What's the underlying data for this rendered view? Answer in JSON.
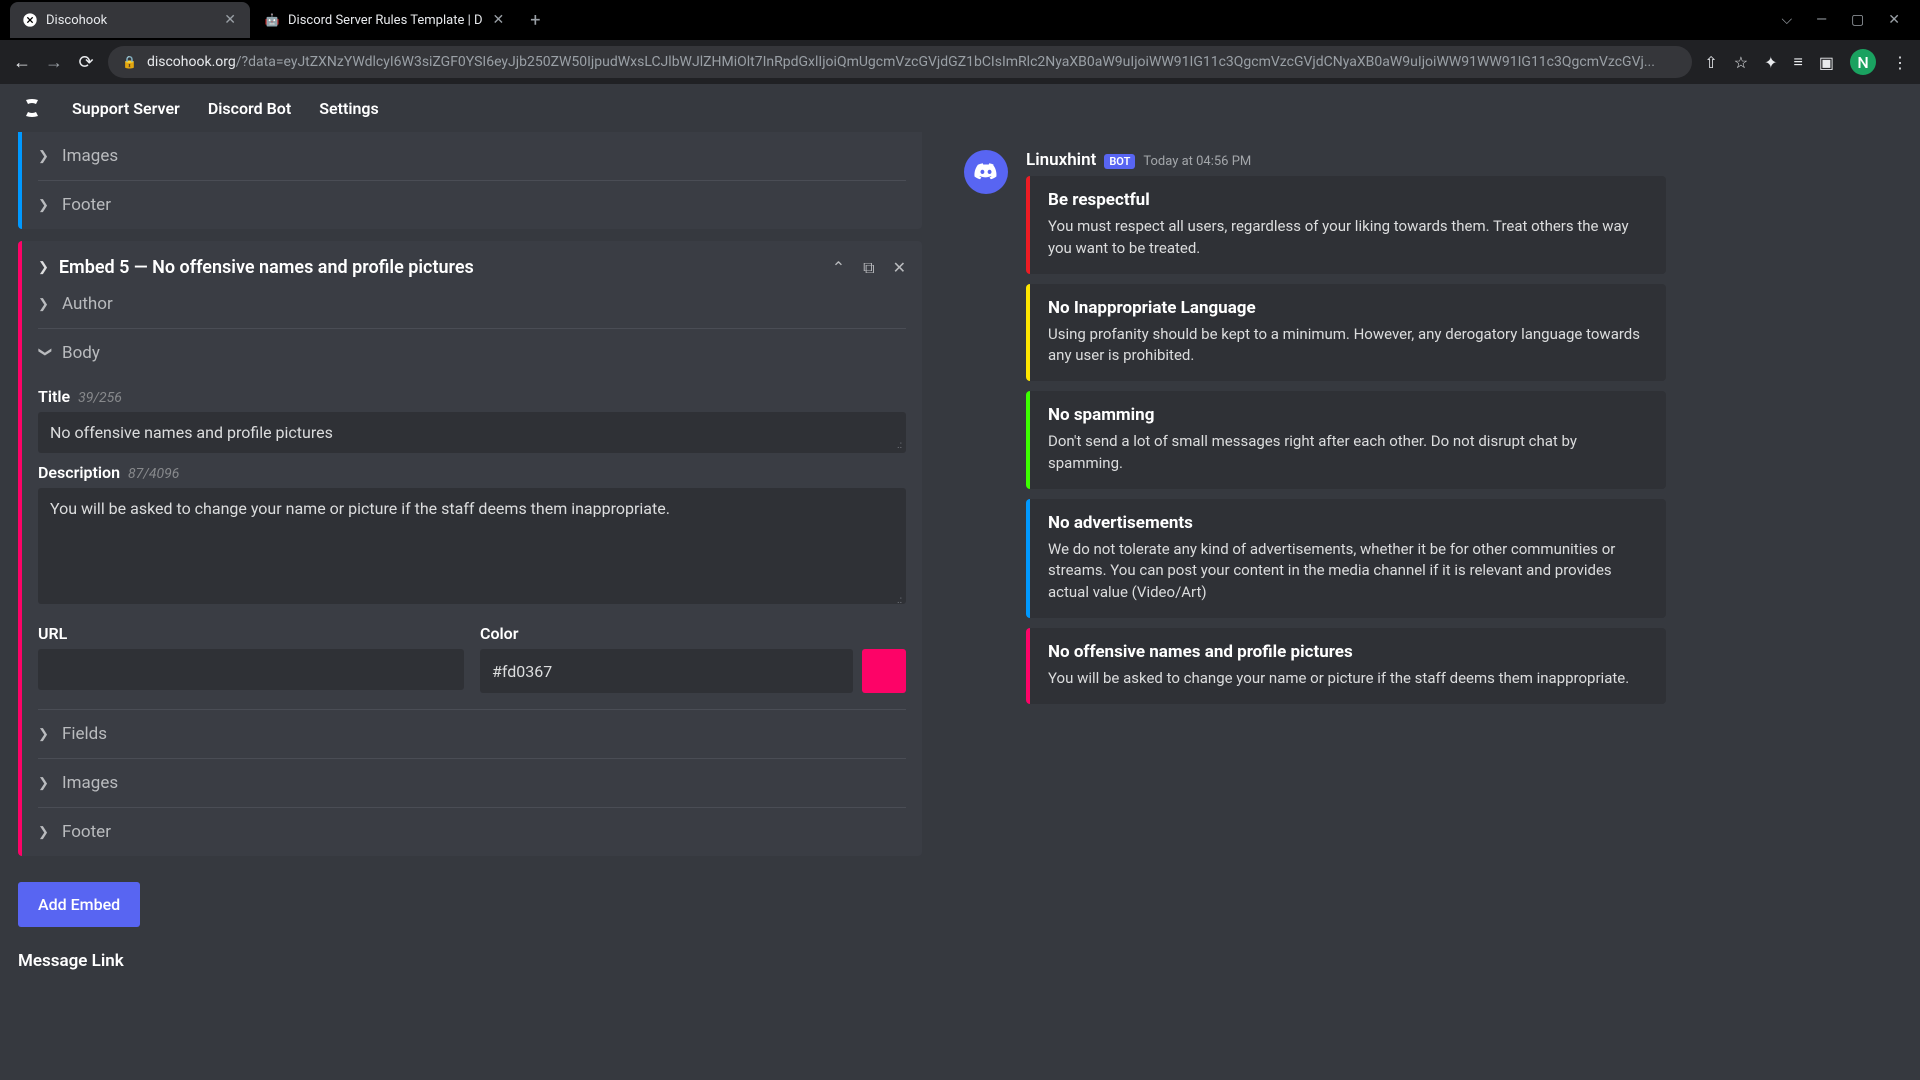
{
  "browser": {
    "tabs": [
      {
        "title": "Discohook",
        "favicon": "S",
        "active": true
      },
      {
        "title": "Discord Server Rules Template | D",
        "favicon": "🤖",
        "active": false
      }
    ],
    "url_prefix": "discohook.org",
    "url_path": "/?data=eyJtZXNzYWdlcyI6W3siZGF0YSI6eyJjb250ZW50IjpudWxsLCJlbWJlZHMiOlt7InRpdGxlIjoiQmUgcmVzcGVjdGZ1bCIsImRlc2NyaXB0aW9uIjoiWW91IG11c3QgcmVzcGVjdCNyaXB0aW9uIjoiWW91WW91IG11c3QgcmVzcGVj...",
    "window_controls": {
      "dropdown": "⌵",
      "minimize": "—",
      "maximize": "▢",
      "close": "✕"
    },
    "profile_letter": "N"
  },
  "app_nav": {
    "support_server": "Support Server",
    "discord_bot": "Discord Bot",
    "settings": "Settings"
  },
  "editor": {
    "prev_embed": {
      "color": "#0099ff",
      "images": "Images",
      "footer": "Footer"
    },
    "embed5": {
      "header": "Embed 5 — No offensive names and profile pictures",
      "color_border": "#fd0367",
      "author": "Author",
      "body_label": "Body",
      "title_label": "Title",
      "title_count": "39/256",
      "title_value": "No offensive names and profile pictures",
      "desc_label": "Description",
      "desc_count": "87/4096",
      "desc_value": "You will be asked to change your name or picture if the staff deems them inappropriate.",
      "url_label": "URL",
      "url_value": "",
      "color_label": "Color",
      "color_value": "#fd0367",
      "fields": "Fields",
      "images": "Images",
      "footer": "Footer"
    },
    "add_embed": "Add Embed",
    "message_link": "Message Link"
  },
  "preview": {
    "username": "Linuxhint",
    "bot_badge": "BOT",
    "timestamp": "Today at 04:56 PM",
    "embeds": [
      {
        "color": "#ed1c24",
        "title": "Be respectful",
        "desc": "You must respect all users, regardless of your liking towards them. Treat others the way you want to be treated."
      },
      {
        "color": "#ffe600",
        "title": "No Inappropriate Language",
        "desc": "Using profanity should be kept to a minimum. However, any derogatory language towards any user is prohibited."
      },
      {
        "color": "#3cff00",
        "title": "No spamming",
        "desc": "Don't send a lot of small messages right after each other. Do not disrupt chat by spamming."
      },
      {
        "color": "#0099ff",
        "title": "No advertisements",
        "desc": "We do not tolerate any kind of advertisements, whether it be for other communities or streams. You can post your content in the media channel if it is relevant and provides actual value (Video/Art)"
      },
      {
        "color": "#fd0367",
        "title": "No offensive names and profile pictures",
        "desc": "You will be asked to change your name or picture if the staff deems them inappropriate."
      }
    ]
  }
}
